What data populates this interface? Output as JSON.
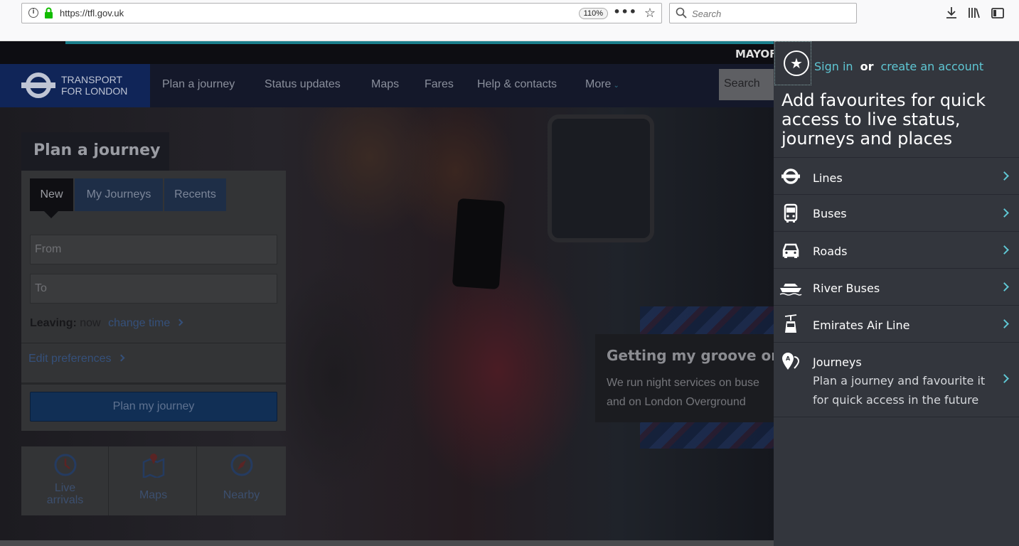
{
  "browser": {
    "url": "https://tfl.gov.uk",
    "zoom": "110%",
    "search_placeholder": "Search"
  },
  "site": {
    "mayor_text": "MAYOF",
    "logo_line1": "TRANSPORT",
    "logo_line2": "FOR LONDON",
    "nav": [
      "Plan a journey",
      "Status updates",
      "Maps",
      "Fares",
      "Help & contacts",
      "More"
    ],
    "search_placeholder": "Search"
  },
  "planner": {
    "title": "Plan a journey",
    "tabs": [
      "New",
      "My Journeys",
      "Recents"
    ],
    "from_placeholder": "From",
    "to_placeholder": "To",
    "leaving_label": "Leaving:",
    "leaving_value": "now",
    "change_time": "change time",
    "edit_preferences": "Edit preferences",
    "plan_button": "Plan my journey"
  },
  "quick_links": [
    {
      "line1": "Live",
      "line2": "arrivals",
      "icon": "clock-icon"
    },
    {
      "line1": "Maps",
      "icon": "map-pin-icon"
    },
    {
      "line1": "Nearby",
      "icon": "compass-icon"
    }
  ],
  "promo": {
    "title": "Getting my groove on n",
    "line1": "We run night services on buse",
    "line2": "and on London Overground"
  },
  "sidebar": {
    "sign_in": "Sign in",
    "or": "or",
    "create_account": "create an account",
    "heading": "Add favourites for quick access to live status, journeys and places",
    "items": [
      {
        "label": "Lines",
        "icon": "roundel-icon"
      },
      {
        "label": "Buses",
        "icon": "bus-icon"
      },
      {
        "label": "Roads",
        "icon": "car-icon"
      },
      {
        "label": "River Buses",
        "icon": "boat-icon"
      },
      {
        "label": "Emirates Air Line",
        "icon": "cable-car-icon"
      },
      {
        "label": "Journeys",
        "icon": "journey-pin-icon",
        "description": "Plan a journey and favourite it for quick access in the future"
      }
    ]
  },
  "colors": {
    "accent": "#5fc7d4",
    "sidebar_bg": "#33363d",
    "tfl_blue": "#102558"
  }
}
